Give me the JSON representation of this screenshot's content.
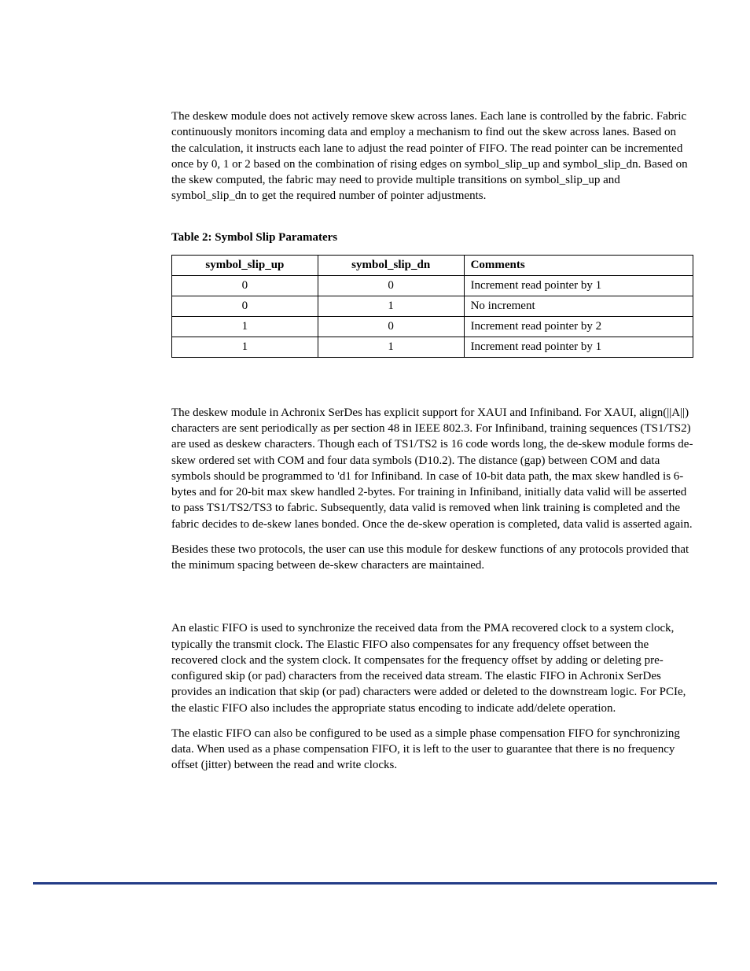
{
  "para1": "The deskew module does not actively remove skew across lanes. Each lane is controlled by the fabric. Fabric continuously monitors incoming data and employ a mechanism to find out the skew across lanes. Based on the calculation, it instructs each lane to adjust the read pointer of FIFO. The read pointer can be incremented once by 0, 1 or 2 based on the combination of rising edges on symbol_slip_up and symbol_slip_dn. Based on the skew computed, the fabric may need to provide multiple transitions on symbol_slip_up and symbol_slip_dn to get the required number of pointer adjustments.",
  "table": {
    "caption": "Table 2: Symbol Slip Paramaters",
    "headers": {
      "col1": "symbol_slip_up",
      "col2": "symbol_slip_dn",
      "col3": "Comments"
    },
    "rows": [
      {
        "c1": "0",
        "c2": "0",
        "c3": "Increment read pointer by 1"
      },
      {
        "c1": "0",
        "c2": "1",
        "c3": "No increment"
      },
      {
        "c1": "1",
        "c2": "0",
        "c3": "Increment read pointer by 2"
      },
      {
        "c1": "1",
        "c2": "1",
        "c3": "Increment read pointer by 1"
      }
    ]
  },
  "para2": "The deskew module in Achronix SerDes has explicit support for XAUI and Infiniband. For XAUI, align(||A||) characters are sent periodically as per section 48 in IEEE 802.3. For Infiniband, training sequences (TS1/TS2) are used as deskew characters. Though each of TS1/TS2 is 16 code words long, the de-skew module forms de-skew ordered set with COM and four data symbols (D10.2). The distance (gap) between COM and data symbols should be programmed to 'd1 for Infiniband. In case of 10-bit data path, the max skew handled is 6-bytes and for 20-bit max skew handled 2-bytes. For training in Infiniband, initially data valid will be asserted to pass TS1/TS2/TS3 to fabric. Subsequently, data valid is removed when link training is completed and the fabric decides to de-skew lanes bonded. Once the de-skew operation is completed, data valid is asserted again.",
  "para3": "Besides these two protocols, the user can use this module for deskew functions of any protocols provided that the minimum spacing between de-skew characters are maintained.",
  "para4": "An elastic FIFO is used to synchronize the received data from the PMA recovered clock to a system clock, typically the transmit clock. The Elastic FIFO also compensates for any frequency offset between the recovered clock and the system clock. It compensates for the frequency offset by adding or deleting pre-configured skip (or pad) characters from the received data stream.  The elastic FIFO in Achronix SerDes provides an indication that skip (or pad) characters were added or deleted to the downstream logic. For PCIe, the elastic FIFO also includes the appropriate status encoding to indicate add/delete operation.",
  "para5": "The elastic FIFO can also be configured to be used as a simple phase compensation FIFO for synchronizing data. When used as a phase compensation FIFO, it is left to the user to guarantee that there is no frequency offset (jitter) between the read and write clocks."
}
